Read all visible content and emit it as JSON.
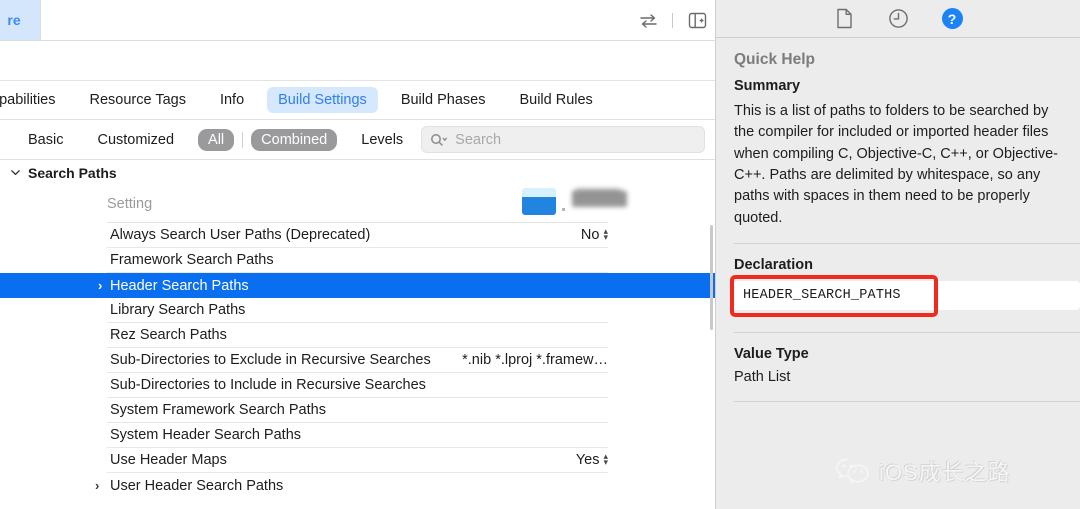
{
  "editor": {
    "tab_fragment_label": "re",
    "toolbar_icons": [
      {
        "name": "related-items-icon"
      },
      {
        "name": "add-editor-icon"
      }
    ]
  },
  "main_tabs": [
    {
      "label": "apabilities",
      "active": false
    },
    {
      "label": "Resource Tags",
      "active": false
    },
    {
      "label": "Info",
      "active": false
    },
    {
      "label": "Build Settings",
      "active": true
    },
    {
      "label": "Build Phases",
      "active": false
    },
    {
      "label": "Build Rules",
      "active": false
    }
  ],
  "filter_bar": {
    "items": [
      {
        "label": "Basic",
        "selected": false
      },
      {
        "label": "Customized",
        "selected": false
      },
      {
        "label": "All",
        "selected": true
      },
      {
        "label": "Combined",
        "selected": true
      },
      {
        "label": "Levels",
        "selected": false
      }
    ],
    "search_placeholder": "Search",
    "search_value": "",
    "search_icon": "magnifier-chevron-icon"
  },
  "settings_table": {
    "group_title": "Search Paths",
    "group_expanded": true,
    "column_header": {
      "setting_label": "Setting",
      "target_name_redacted": true
    },
    "rows": [
      {
        "name": "Always Search User Paths (Deprecated)",
        "value": "No",
        "control": "popup",
        "disclosure": false,
        "selected": false
      },
      {
        "name": "Framework Search Paths",
        "value": "",
        "control": "none",
        "disclosure": false,
        "selected": false
      },
      {
        "name": "Header Search Paths",
        "value": "",
        "control": "none",
        "disclosure": true,
        "selected": true
      },
      {
        "name": "Library Search Paths",
        "value": "",
        "control": "none",
        "disclosure": false,
        "selected": false
      },
      {
        "name": "Rez Search Paths",
        "value": "",
        "control": "none",
        "disclosure": false,
        "selected": false
      },
      {
        "name": "Sub-Directories to Exclude in Recursive Searches",
        "value": "*.nib *.lproj *.framew…",
        "control": "none",
        "disclosure": false,
        "selected": false
      },
      {
        "name": "Sub-Directories to Include in Recursive Searches",
        "value": "",
        "control": "none",
        "disclosure": false,
        "selected": false
      },
      {
        "name": "System Framework Search Paths",
        "value": "",
        "control": "none",
        "disclosure": false,
        "selected": false
      },
      {
        "name": "System Header Search Paths",
        "value": "",
        "control": "none",
        "disclosure": false,
        "selected": false
      },
      {
        "name": "Use Header Maps",
        "value": "Yes",
        "control": "popup",
        "disclosure": false,
        "selected": false
      },
      {
        "name": "User Header Search Paths",
        "value": "",
        "control": "none",
        "disclosure": true,
        "selected": false
      }
    ]
  },
  "inspector": {
    "tabs": [
      {
        "name": "file-inspector-icon",
        "active": false
      },
      {
        "name": "history-inspector-icon",
        "active": false
      },
      {
        "name": "quick-help-inspector-icon",
        "active": true,
        "glyph": "?"
      }
    ],
    "panel_title": "Quick Help",
    "summary": {
      "heading": "Summary",
      "body": "This is a list of paths to folders to be searched by the compiler for included or imported header files when compiling C, Objective-C, C++, or Objective-C++. Paths are delimited by whitespace, so any paths with spaces in them need to be properly quoted."
    },
    "declaration": {
      "heading": "Declaration",
      "value": "HEADER_SEARCH_PATHS",
      "highlight_color": "#EF2B20"
    },
    "value_type": {
      "heading": "Value Type",
      "value": "Path List"
    },
    "watermark": {
      "text": "iOS成长之路",
      "logo": "wechat-logo-icon"
    }
  },
  "colors": {
    "selection_blue": "#0A6EF0",
    "active_tab_bg": "#D6E8FD",
    "active_tab_text": "#2F7FF0",
    "pill_gray": "#9A9A9C",
    "inspector_bg": "#ECECEC"
  }
}
